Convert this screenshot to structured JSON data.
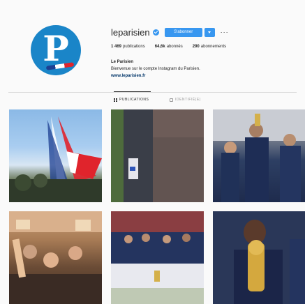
{
  "profile": {
    "username": "leparisien",
    "avatar_letter": "P",
    "follow_label": "S'abonner",
    "more_label": "···",
    "stats": [
      {
        "value": "1 469",
        "label": "publications"
      },
      {
        "value": "64,6k",
        "label": "abonnés"
      },
      {
        "value": "290",
        "label": "abonnements"
      }
    ],
    "name": "Le Parisien",
    "bio": "Bienvenue sur le compte Instagram du Parisien.",
    "website": "www.leparisien.fr"
  },
  "tabs": [
    {
      "label": "PUBLICATIONS",
      "active": true,
      "icon": "grid-icon"
    },
    {
      "label": "IDENTIFIÉ(E)",
      "active": false,
      "icon": "tag-icon"
    }
  ],
  "posts": [
    {
      "subject": "patrouille-de-france-flyover"
    },
    {
      "subject": "champs-elysees-crowd-parade"
    },
    {
      "subject": "team-trophy-celebration"
    },
    {
      "subject": "fans-celebrating-bar"
    },
    {
      "subject": "team-photo-trophy"
    },
    {
      "subject": "player-kissing-world-cup"
    }
  ],
  "colors": {
    "accent": "#3897f0",
    "avatar": "#1a85c8",
    "background": "#fafafa"
  }
}
